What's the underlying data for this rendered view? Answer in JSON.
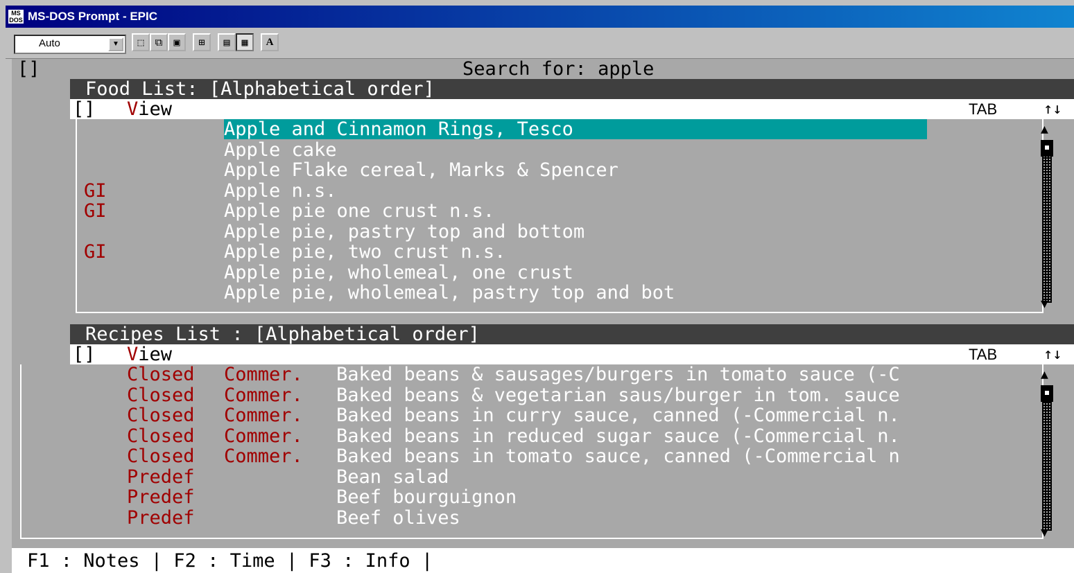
{
  "window": {
    "title": "MS-DOS Prompt - EPIC",
    "icon_text": "MS\nDOS"
  },
  "toolbar": {
    "font_size": "Auto",
    "buttons": [
      "mark-icon",
      "copy-icon",
      "paste-icon",
      "fullscreen-icon",
      "properties-icon",
      "background-icon",
      "font-icon"
    ],
    "font_label": "A"
  },
  "screen": {
    "corner": "[]",
    "search": "Search for: apple",
    "food": {
      "header": "Food List: [Alphabetical order]",
      "view_bracket": "[]",
      "view_v": "V",
      "view_rest": "iew",
      "tab": "TAB",
      "arrows": "↑↓",
      "items": [
        {
          "gi": "",
          "name": "Apple and Cinnamon Rings, Tesco",
          "selected": true
        },
        {
          "gi": "",
          "name": "Apple cake"
        },
        {
          "gi": "",
          "name": "Apple Flake cereal, Marks & Spencer"
        },
        {
          "gi": "GI",
          "name": "Apple n.s."
        },
        {
          "gi": "GI",
          "name": "Apple pie one crust n.s."
        },
        {
          "gi": "",
          "name": "Apple pie, pastry top and bottom"
        },
        {
          "gi": "GI",
          "name": "Apple pie, two crust n.s."
        },
        {
          "gi": "",
          "name": "Apple pie, wholemeal, one crust"
        },
        {
          "gi": "",
          "name": "Apple pie, wholemeal, pastry top and bot"
        }
      ]
    },
    "recipes": {
      "header": "Recipes List : [Alphabetical order]",
      "view_bracket": "[]",
      "view_v": "V",
      "view_rest": "iew",
      "tab": "TAB",
      "arrows": "↑↓",
      "items": [
        {
          "status": "Closed",
          "type": "Commer.",
          "name": "Baked beans & sausages/burgers in tomato sauce (-C"
        },
        {
          "status": "Closed",
          "type": "Commer.",
          "name": "Baked beans & vegetarian saus/burger in tom. sauce"
        },
        {
          "status": "Closed",
          "type": "Commer.",
          "name": "Baked beans in curry sauce, canned (-Commercial n."
        },
        {
          "status": "Closed",
          "type": "Commer.",
          "name": "Baked beans in reduced sugar sauce (-Commercial n."
        },
        {
          "status": "Closed",
          "type": "Commer.",
          "name": "Baked beans in tomato sauce, canned (-Commercial n"
        },
        {
          "status": "Predef",
          "type": "",
          "name": "Bean salad"
        },
        {
          "status": "Predef",
          "type": "",
          "name": "Beef bourguignon"
        },
        {
          "status": "Predef",
          "type": "",
          "name": "Beef olives"
        }
      ]
    },
    "status_bar": "F1 : Notes | F2 : Time | F3 : Info |"
  },
  "colors": {
    "background": "#a8a8a8",
    "selection": "#009c9c",
    "accent_red": "#a00000",
    "header_bar": "#3f3f3f"
  }
}
